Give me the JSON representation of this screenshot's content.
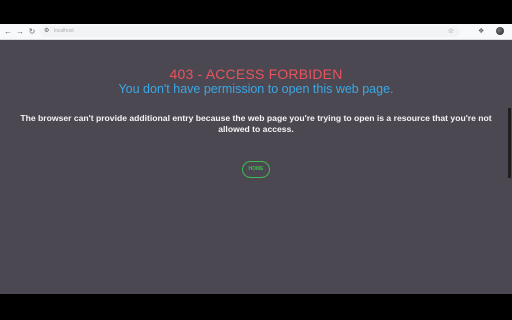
{
  "browser": {
    "url": "localhost",
    "icons": {
      "back": "arrow-left-icon",
      "forward": "arrow-right-icon",
      "reload": "reload-icon",
      "site_info": "site-info-icon",
      "bookmark": "star-icon",
      "extensions": "extensions-icon",
      "profile": "avatar"
    }
  },
  "page": {
    "title": "403 - ACCESS FORBIDEN",
    "subtitle": "You don't have permission to open this web page.",
    "description": "The browser can't provide additional entry because the web page you're trying to open is a resource that you're not allowed to access.",
    "home_button": "HOME"
  },
  "colors": {
    "page_background": "#4c4852",
    "title": "#e8535d",
    "subtitle": "#3aa8e6",
    "description": "#f4f4f4",
    "home_button": "#3fb950"
  }
}
